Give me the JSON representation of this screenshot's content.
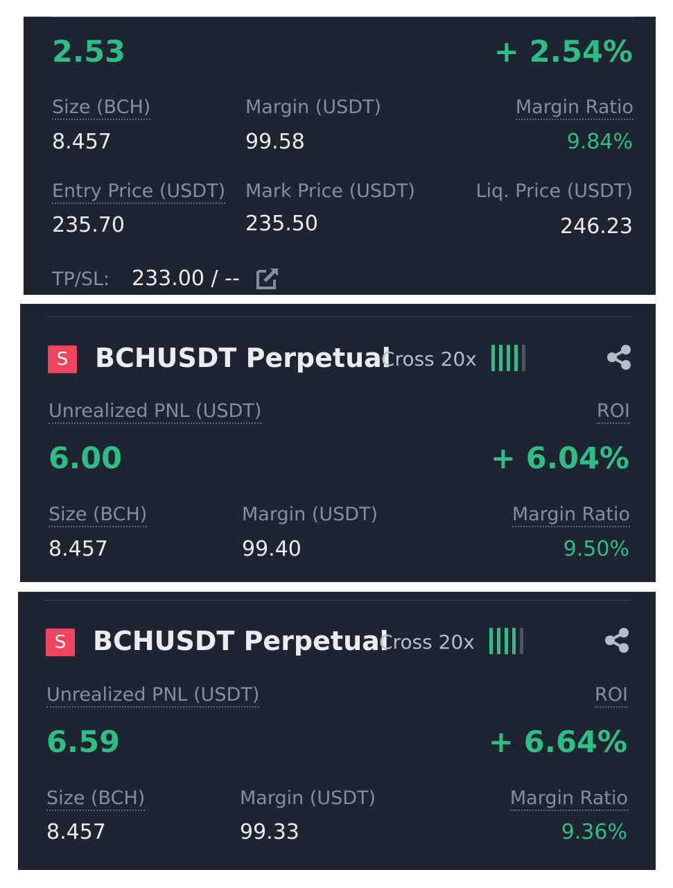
{
  "colors": {
    "panel_bg": "#1f2530",
    "green": "#2ebd85",
    "badge_red": "#f0445f",
    "label_gray": "#848e9c"
  },
  "icons": [
    "share-icon",
    "edit-icon"
  ],
  "card1": {
    "pnl": "2.53",
    "roi": "+ 2.54%",
    "size_label": "Size (BCH)",
    "size": "8.457",
    "margin_label": "Margin (USDT)",
    "margin": "99.58",
    "ratio_label": "Margin Ratio",
    "ratio": "9.84%",
    "entry_label": "Entry Price (USDT)",
    "entry": "235.70",
    "mark_label": "Mark Price (USDT)",
    "mark": "235.50",
    "liq_label": "Liq. Price (USDT)",
    "liq": "246.23",
    "tpsl_label": "TP/SL:",
    "tpsl": "233.00 / --"
  },
  "card2": {
    "badge": "S",
    "symbol": "BCHUSDT Perpetual",
    "mode": "Cross 20x",
    "pnl_label": "Unrealized PNL (USDT)",
    "roi_label": "ROI",
    "pnl": "6.00",
    "roi": "+ 6.04%",
    "size_label": "Size (BCH)",
    "size": "8.457",
    "margin_label": "Margin (USDT)",
    "margin": "99.40",
    "ratio_label": "Margin Ratio",
    "ratio": "9.50%"
  },
  "card3": {
    "badge": "S",
    "symbol": "BCHUSDT Perpetual",
    "mode": "Cross 20x",
    "pnl_label": "Unrealized PNL (USDT)",
    "roi_label": "ROI",
    "pnl": "6.59",
    "roi": "+ 6.64%",
    "size_label": "Size (BCH)",
    "size": "8.457",
    "margin_label": "Margin (USDT)",
    "margin": "99.33",
    "ratio_label": "Margin Ratio",
    "ratio": "9.36%"
  }
}
